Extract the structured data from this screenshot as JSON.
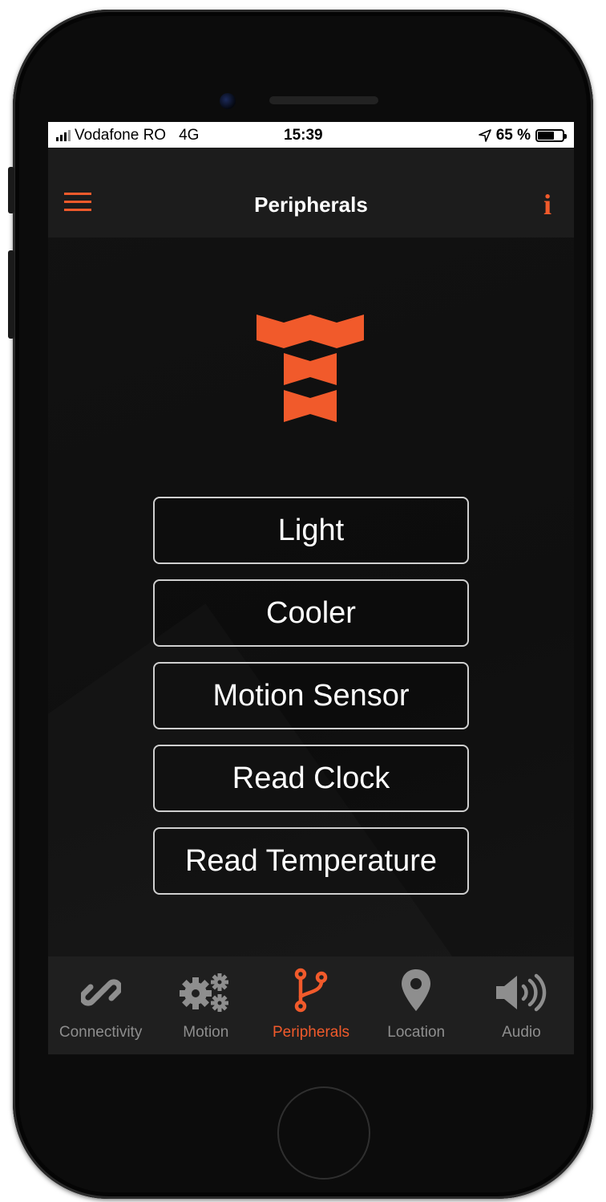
{
  "status_bar": {
    "carrier": "Vodafone RO",
    "network": "4G",
    "time": "15:39",
    "battery": "65 %",
    "battery_level": 0.65
  },
  "nav": {
    "title": "Peripherals",
    "menu_icon": "hamburger-menu-icon",
    "info_icon": "info-icon",
    "info_glyph": "i"
  },
  "logo_icon": "brand-logo",
  "buttons": [
    "Light",
    "Cooler",
    "Motion Sensor",
    "Read Clock",
    "Read Temperature"
  ],
  "tabs": [
    {
      "label": "Connectivity",
      "icon": "link-icon",
      "active": false
    },
    {
      "label": "Motion",
      "icon": "gears-icon",
      "active": false
    },
    {
      "label": "Peripherals",
      "icon": "branch-icon",
      "active": true
    },
    {
      "label": "Location",
      "icon": "location-pin-icon",
      "active": false
    },
    {
      "label": "Audio",
      "icon": "speaker-icon",
      "active": false
    }
  ],
  "colors": {
    "accent": "#f15a2b",
    "background": "#121212",
    "inactive": "#8e8e8e"
  }
}
